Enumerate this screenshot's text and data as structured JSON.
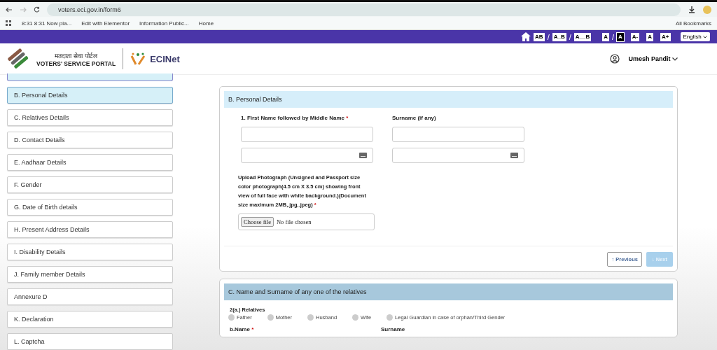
{
  "browser": {
    "url": "voters.eci.gov.in/form6",
    "bookmarks": [
      "8:31 8:31 Now pla...",
      "Edit with Elementor",
      "Information Public...",
      "Home"
    ],
    "all_bookmarks": "All Bookmarks"
  },
  "access_bar": {
    "spacing": [
      {
        "label": "AB",
        "selected": false
      },
      {
        "label": "A_B",
        "selected": false
      },
      {
        "label": "A__B",
        "selected": false
      }
    ],
    "separator": "/",
    "contrast": [
      {
        "label": "A",
        "selected": false
      },
      {
        "label": "A",
        "selected": true
      }
    ],
    "sizes": [
      "A-",
      "A",
      "A+"
    ],
    "language": "English"
  },
  "header": {
    "hindi_title": "मतदाता सेवा पोर्टल",
    "title": "VOTERS' SERVICE PORTAL",
    "brand": "ECINet",
    "user": "Umesh Pandit"
  },
  "sidebar": {
    "items": [
      {
        "label": "B. Personal Details",
        "selected": true
      },
      {
        "label": "C. Relatives Details",
        "selected": false
      },
      {
        "label": "D. Contact Details",
        "selected": false
      },
      {
        "label": "E. Aadhaar Details",
        "selected": false
      },
      {
        "label": "F. Gender",
        "selected": false
      },
      {
        "label": "G. Date of Birth details",
        "selected": false
      },
      {
        "label": "H. Present Address Details",
        "selected": false
      },
      {
        "label": "I. Disability Details",
        "selected": false
      },
      {
        "label": "J. Family member Details",
        "selected": false
      },
      {
        "label": "Annexure D",
        "selected": false
      },
      {
        "label": "K. Declaration",
        "selected": false
      },
      {
        "label": "L. Captcha",
        "selected": false
      }
    ]
  },
  "personal": {
    "title": "B. Personal Details",
    "first_name_label": "1. First Name followed by Middle Name",
    "surname_label": "Surname (if any)",
    "upload_label": "Upload Photograph (Unsigned and Passport size color photograph(4.5 cm X 3.5 cm) showing front view of full face with white background.)(Document size maximum 2MB,.jpg,.jpeg)",
    "choose_file": "Choose file",
    "no_file": "No file chosen",
    "required_mark": "*",
    "previous": "↑ Previous",
    "next": "↓ Next",
    "next_disabled": true
  },
  "relatives": {
    "title": "C. Name and Surname of any one of the relatives",
    "question": "2(a.) Relatives",
    "options": [
      {
        "label": "Father",
        "checked": false
      },
      {
        "label": "Mother",
        "checked": false
      },
      {
        "label": "Husband",
        "checked": false
      },
      {
        "label": "Wife",
        "checked": false
      },
      {
        "label": "Legal Guardian in case of orphan/Third Gender",
        "checked": false
      }
    ],
    "name_label": "b.Name",
    "required_mark": "*",
    "surname_label": "Surname"
  }
}
